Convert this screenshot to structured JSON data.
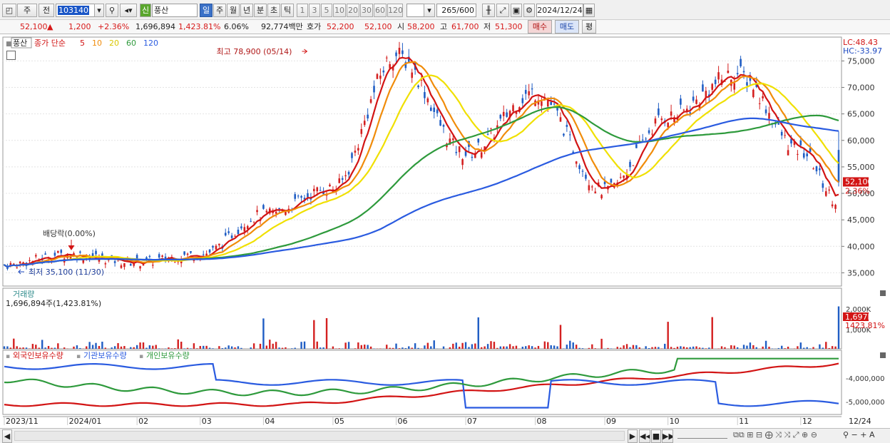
{
  "toolbar": {
    "market_type": "주",
    "prev_label": "전",
    "stock_code": "103140",
    "new_label": "신",
    "stock_name": "풍산",
    "periods": [
      "일",
      "주",
      "월",
      "년",
      "분",
      "초",
      "틱"
    ],
    "tick_options": [
      "1",
      "3",
      "5",
      "10",
      "20",
      "30",
      "60",
      "120"
    ],
    "count_value": "265",
    "count_total": "/600",
    "date_value": "2024/12/24"
  },
  "quote": {
    "price": "52,100",
    "change": "1,200",
    "change_pct": "+2.36%",
    "volume": "1,696,894",
    "volume_pct": "1,423.81%",
    "turnover": "6.06%",
    "amount": "92,774백만",
    "bid_label": "호가",
    "bid1": "52,200",
    "bid2": "52,100",
    "open_label": "시",
    "open": "58,200",
    "high_label": "고",
    "high": "61,700",
    "low_label": "저",
    "low": "51,300",
    "buy_button": "매수",
    "sell_button": "매도",
    "eval_button": "평"
  },
  "price_panel": {
    "stock_tag": "풍산",
    "indicator_label": "종가 단순",
    "ma_periods": [
      "5",
      "10",
      "20",
      "60",
      "120"
    ],
    "ma_colors": [
      "#d21414",
      "#f08c0a",
      "#f0e000",
      "#2e9a3c",
      "#2a5be0"
    ],
    "lc": "LC:48.43",
    "hc": "HC:-33.97",
    "high_annotation": "최고 78,900 (05/14)",
    "low_annotation": "최저 35,100 (11/30)",
    "dividend_annotation": "배당락(0.00%)",
    "current_price_tag": "52,100",
    "current_change_tag": "2.36%"
  },
  "volume_panel": {
    "title": "거래량",
    "value_text": "1,696,894주(1,423.81%)",
    "tag_volume": "1,697K",
    "tag_pct": "1423.81%",
    "axis_top": "2,000K",
    "axis_mid": "1,000K"
  },
  "holdings_panel": {
    "labels": [
      "외국인보유수량",
      "기관보유수량",
      "개인보유수량"
    ],
    "colors": [
      "#d21414",
      "#2a5be0",
      "#2e9a3c"
    ],
    "axis": [
      "-4,000,000",
      "-5,000,000"
    ]
  },
  "x_axis_labels": [
    "2023/11",
    "2024/01",
    "02",
    "03",
    "04",
    "05",
    "06",
    "07",
    "08",
    "09",
    "10",
    "11",
    "12",
    "12/24"
  ],
  "chart_data": {
    "type": "line",
    "price_axis": [
      "75,000",
      "70,000",
      "65,000",
      "60,000",
      "55,000",
      "50,000",
      "45,000",
      "40,000",
      "35,000"
    ],
    "ylim": [
      32500,
      79500
    ],
    "close_keypoints": [
      {
        "x": "2023/11",
        "y": 36500
      },
      {
        "x": "2023/12",
        "y": 38500
      },
      {
        "x": "2024/01",
        "y": 37000
      },
      {
        "x": "2024/02",
        "y": 38500
      },
      {
        "x": "2024/03",
        "y": 46000
      },
      {
        "x": "2024/04",
        "y": 51000
      },
      {
        "x": "2024/05",
        "y": 76000
      },
      {
        "x": "2024/06",
        "y": 57500
      },
      {
        "x": "2024/07",
        "y": 69000
      },
      {
        "x": "2024/08",
        "y": 50500
      },
      {
        "x": "2024/09",
        "y": 64500
      },
      {
        "x": "2024/10",
        "y": 72500
      },
      {
        "x": "2024/11",
        "y": 58000
      },
      {
        "x": "2024/12",
        "y": 48500
      },
      {
        "x": "2024/12/24",
        "y": 52100
      }
    ]
  },
  "footer": {
    "nav_buttons": [
      "◀",
      "▶",
      "|◀◀",
      "■",
      "▶▶|"
    ]
  }
}
